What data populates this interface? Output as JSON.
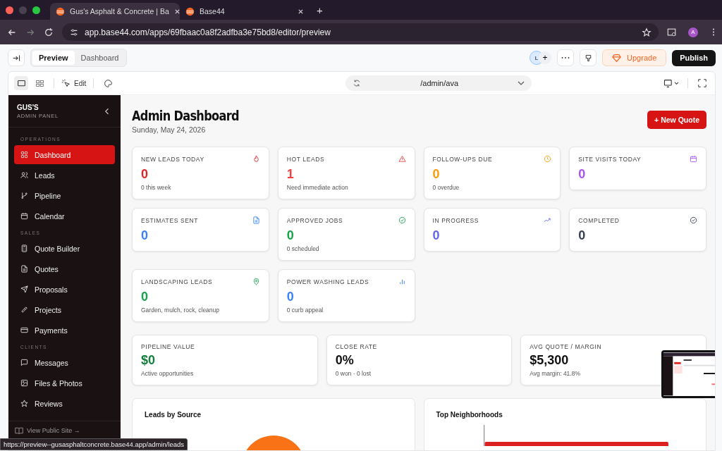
{
  "browser": {
    "tabs": [
      {
        "title": "Gus's Asphalt & Concrete | Ba",
        "selected": true
      },
      {
        "title": "Base44",
        "selected": false
      }
    ],
    "new_tab": "+",
    "url": "app.base44.com/apps/69fbaac0a8f2adfba3e75bd8/editor/preview",
    "profile": "A"
  },
  "editor": {
    "view_tabs": [
      {
        "label": "Preview",
        "selected": true
      },
      {
        "label": "Dashboard",
        "selected": false
      }
    ],
    "collaborator": "L",
    "invite": "+",
    "upgrade": "Upgrade",
    "publish": "Publish"
  },
  "preview_bar": {
    "edit": "Edit",
    "route": "/admin/ava"
  },
  "sidebar": {
    "brand": "GUS'S",
    "subtitle": "ADMIN PANEL",
    "sections": [
      {
        "title": "OPERATIONS",
        "items": [
          {
            "label": "Dashboard",
            "selected": true
          },
          {
            "label": "Leads",
            "selected": false
          },
          {
            "label": "Pipeline",
            "selected": false
          },
          {
            "label": "Calendar",
            "selected": false
          }
        ]
      },
      {
        "title": "SALES",
        "items": [
          {
            "label": "Quote Builder",
            "selected": false
          },
          {
            "label": "Quotes",
            "selected": false
          },
          {
            "label": "Proposals",
            "selected": false
          },
          {
            "label": "Projects",
            "selected": false
          },
          {
            "label": "Payments",
            "selected": false
          }
        ]
      },
      {
        "title": "CLIENTS",
        "items": [
          {
            "label": "Messages",
            "selected": false
          },
          {
            "label": "Files & Photos",
            "selected": false
          },
          {
            "label": "Reviews",
            "selected": false
          }
        ]
      }
    ],
    "footer": "View Public Site →"
  },
  "main": {
    "title": "Admin Dashboard",
    "date": "Sunday, May 24, 2026",
    "new_quote": "+ New Quote",
    "stat_cards": [
      {
        "label": "NEW LEADS TODAY",
        "value": "0",
        "note": "0 this week",
        "color": "#dc2626"
      },
      {
        "label": "HOT LEADS",
        "value": "1",
        "note": "Need immediate action",
        "color": "#ef4444"
      },
      {
        "label": "FOLLOW-UPS DUE",
        "value": "0",
        "note": "0 overdue",
        "color": "#f59e0b"
      },
      {
        "label": "SITE VISITS TODAY",
        "value": "0",
        "color": "#a855f7"
      },
      {
        "label": "ESTIMATES SENT",
        "value": "0",
        "color": "#3b82f6"
      },
      {
        "label": "APPROVED JOBS",
        "value": "0",
        "note": "0 scheduled",
        "color": "#16a34a"
      },
      {
        "label": "IN PROGRESS",
        "value": "0",
        "color": "#6366f1"
      },
      {
        "label": "COMPLETED",
        "value": "0",
        "color": "#374151"
      },
      {
        "label": "LANDSCAPING LEADS",
        "value": "0",
        "note": "Garden, mulch, rock, cleanup",
        "color": "#16a34a"
      },
      {
        "label": "POWER WASHING LEADS",
        "value": "0",
        "note": "0 curb appeal",
        "color": "#3b82f6"
      }
    ],
    "summary_cards": [
      {
        "label": "PIPELINE VALUE",
        "value": "$0",
        "note": "Active opportunities",
        "color": "#15803d"
      },
      {
        "label": "CLOSE RATE",
        "value": "0%",
        "note": "0 won · 0 lost",
        "color": "#111111"
      },
      {
        "label": "AVG QUOTE / MARGIN",
        "value": "$5,300",
        "note": "Avg margin: 41.8%",
        "color": "#111111"
      }
    ],
    "panels": [
      {
        "title": "Leads by Source",
        "kind": "pie"
      },
      {
        "title": "Top Neighborhoods",
        "kind": "bar"
      }
    ]
  },
  "status_url": "https://preview--gusasphaltconcrete.base44.app/admin/leads"
}
